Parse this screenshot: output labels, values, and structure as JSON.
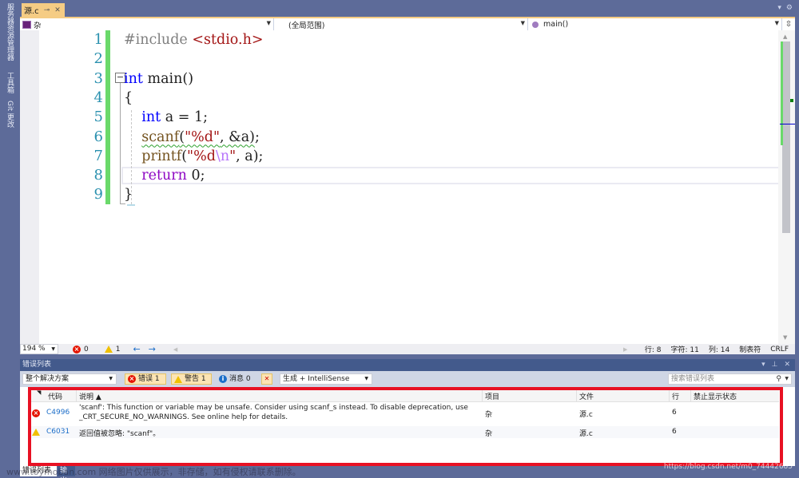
{
  "side_strip": {
    "tabs": [
      "服务器资源管理器",
      "工具箱",
      "Git 更改"
    ]
  },
  "tab_row": {
    "active_tab": {
      "label": "源.c",
      "pin_icon": "pin-icon",
      "close_icon": "close-icon"
    },
    "right_controls": [
      "▾",
      "⚙"
    ]
  },
  "nav_bar": {
    "project": "杂",
    "scope": "(全局范围)",
    "member": "main()",
    "split_icon": "split-icon"
  },
  "editor": {
    "line_numbers": [
      "1",
      "2",
      "3",
      "4",
      "5",
      "6",
      "7",
      "8",
      "9"
    ],
    "code_lines": [
      [
        {
          "t": "#include ",
          "c": "inc"
        },
        {
          "t": "<stdio.h>",
          "c": "incp"
        }
      ],
      [],
      [
        {
          "t": "int",
          "c": "kw"
        },
        {
          "t": " main()",
          "c": ""
        }
      ],
      [
        {
          "t": "{",
          "c": ""
        }
      ],
      [
        {
          "t": "    ",
          "c": ""
        },
        {
          "t": "int",
          "c": "kw"
        },
        {
          "t": " a = 1;",
          "c": ""
        }
      ],
      [
        {
          "t": "    ",
          "c": ""
        },
        {
          "t": "scanf(\"%d\", &a)",
          "c": "squigline"
        },
        {
          "t": ";",
          "c": ""
        }
      ],
      [
        {
          "t": "    ",
          "c": ""
        },
        {
          "t": "printf",
          "c": "fn"
        },
        {
          "t": "(",
          "c": ""
        },
        {
          "t": "\"%d",
          "c": "str"
        },
        {
          "t": "\\n",
          "c": "esc"
        },
        {
          "t": "\"",
          "c": "str"
        },
        {
          "t": ", a);",
          "c": ""
        }
      ],
      [
        {
          "t": "    ",
          "c": ""
        },
        {
          "t": "return",
          "c": "ctl"
        },
        {
          "t": " 0;",
          "c": ""
        }
      ],
      [
        {
          "t": "}",
          "c": ""
        }
      ]
    ],
    "current_line": 8
  },
  "status": {
    "zoom": "194 %",
    "errors": "0",
    "warnings": "1",
    "line": "行: 8",
    "char": "字符: 11",
    "col": "列: 14",
    "indent": "制表符",
    "eol": "CRLF"
  },
  "error_list": {
    "title": "错误列表",
    "scope": "整个解决方案",
    "errors_label": "错误 1",
    "warnings_label": "警告 1",
    "messages_label": "消息 0",
    "build_filter": "生成 + IntelliSense",
    "search_placeholder": "搜索错误列表",
    "columns": [
      "代码",
      "说明 ▲",
      "项目",
      "文件",
      "行",
      "禁止显示状态"
    ],
    "rows": [
      {
        "severity": "error",
        "code": "C4996",
        "description_line1": "'scanf': This function or variable may be unsafe. Consider using scanf_s instead. To disable deprecation, use",
        "description_line2": "_CRT_SECURE_NO_WARNINGS. See online help for details.",
        "project": "杂",
        "file": "源.c",
        "line": "6",
        "suppression": ""
      },
      {
        "severity": "warning",
        "code": "C6031",
        "description_line1": "返回值被忽略: \"scanf\"。",
        "description_line2": "",
        "project": "杂",
        "file": "源.c",
        "line": "6",
        "suppression": ""
      }
    ]
  },
  "bottom_tabs": [
    "错误列表",
    "输出"
  ],
  "watermarks": {
    "left": "www.toymoban.com 网络图片仅供展示，非存储，如有侵权请联系删除。",
    "right": "https://blog.csdn.net/m0_74442685"
  },
  "colors": {
    "accent_tab": "#f5cc84",
    "chrome": "#5d6b99",
    "panel_title": "#435a8c",
    "highlight_box": "#e81123",
    "change_bar": "#6ad96a"
  }
}
